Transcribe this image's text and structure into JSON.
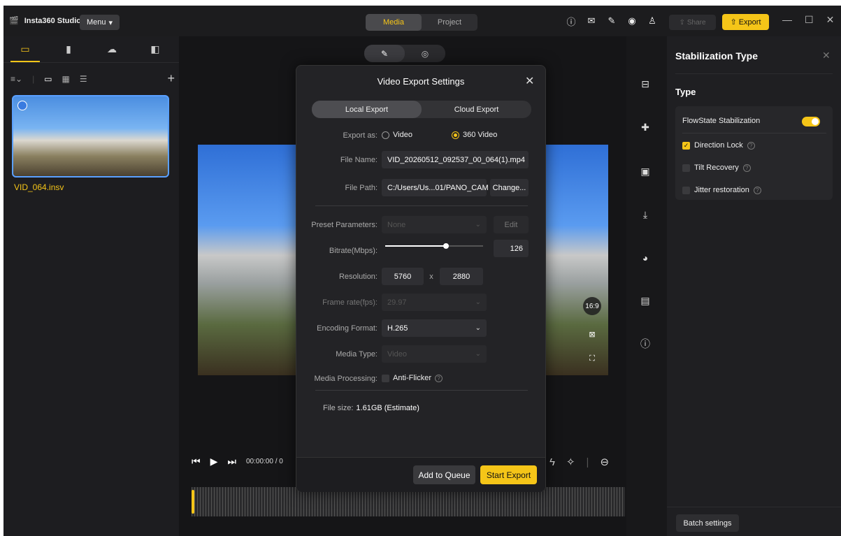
{
  "titlebar": {
    "app_name": "Insta360 Studio",
    "menu_label": "Menu",
    "tabs": [
      {
        "label": "Media",
        "active": true
      },
      {
        "label": "Project",
        "active": false
      }
    ],
    "share_label": "Share",
    "export_label": "Export"
  },
  "left": {
    "file_name": "VID_064.insv"
  },
  "player": {
    "time": "00:00:00 / 0",
    "ratio": "16:9"
  },
  "modal": {
    "title": "Video Export Settings",
    "tabs": [
      {
        "label": "Local Export",
        "active": true
      },
      {
        "label": "Cloud Export",
        "active": false
      }
    ],
    "export_as_label": "Export as:",
    "export_as_options": [
      {
        "label": "Video",
        "selected": false
      },
      {
        "label": "360 Video",
        "selected": true
      }
    ],
    "file_name_label": "File Name:",
    "file_name": "VID_20260512_092537_00_064(1).mp4",
    "file_path_label": "File Path:",
    "file_path": "C:/Users/Us...01/PANO_CAM",
    "change_label": "Change...",
    "preset_label": "Preset Parameters:",
    "preset_value": "None",
    "edit_label": "Edit",
    "bitrate_label": "Bitrate(Mbps):",
    "bitrate_value": "126",
    "bitrate_level": 0.62,
    "resolution_label": "Resolution:",
    "resolution_w": "5760",
    "resolution_x": "x",
    "resolution_h": "2880",
    "framerate_label": "Frame rate(fps):",
    "framerate_value": "29.97",
    "encoding_label": "Encoding Format:",
    "encoding_value": "H.265",
    "media_type_label": "Media Type:",
    "media_type_value": "Video",
    "media_proc_label": "Media Processing:",
    "anti_flicker_label": "Anti-Flicker",
    "file_size_label": "File size:",
    "file_size_value": "1.61GB (Estimate)",
    "add_queue_label": "Add to Queue",
    "start_export_label": "Start Export"
  },
  "right_panel": {
    "title": "Stabilization Type",
    "section": "Type",
    "flowstate_label": "FlowState Stabilization",
    "options": [
      {
        "label": "Direction Lock",
        "checked": true
      },
      {
        "label": "Tilt Recovery",
        "checked": false
      },
      {
        "label": "Jitter restoration",
        "checked": false
      }
    ],
    "batch_label": "Batch settings"
  },
  "colors": {
    "accent": "#f5c518",
    "bg": "#18181a"
  }
}
